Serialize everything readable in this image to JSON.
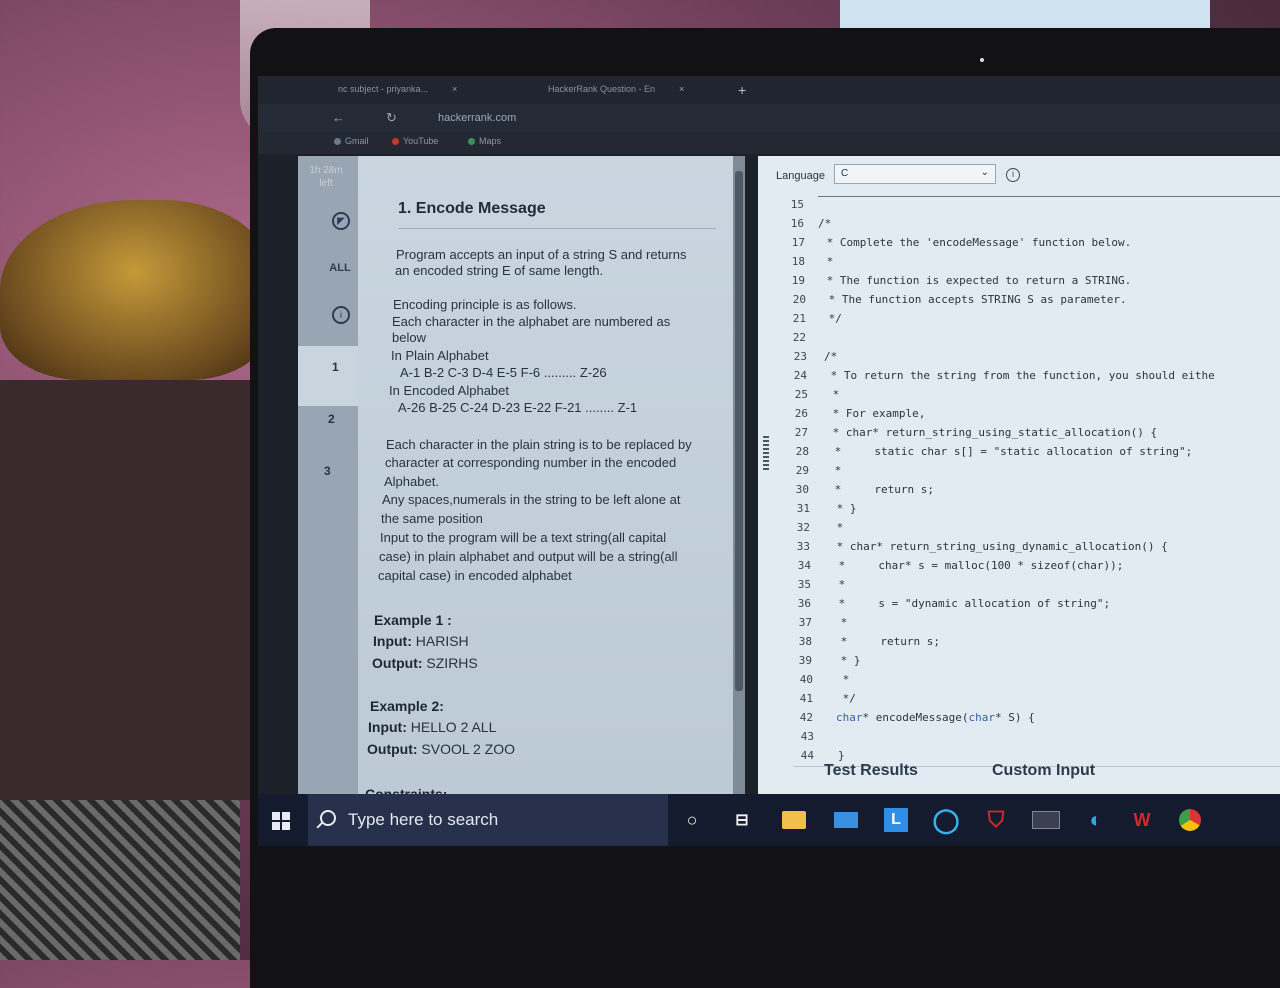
{
  "browser": {
    "tabs": [
      {
        "label": "nc subject - priyanka..."
      },
      {
        "label": "HackerRank Question - En"
      }
    ],
    "url": "hackerrank.com",
    "bookmarks": [
      "Gmail",
      "YouTube",
      "Maps"
    ]
  },
  "rail": {
    "timer": "1h 28m left",
    "all_label": "ALL",
    "questions": [
      "1",
      "2",
      "3"
    ]
  },
  "problem": {
    "title": "1. Encode Message",
    "lines": [
      "Program accepts an input of a string S and returns",
      "an encoded string E of same length.",
      "Encoding principle is as follows.",
      "Each character in the alphabet are numbered as",
      "below",
      "In Plain Alphabet",
      "A-1 B-2 C-3 D-4  E-5 F-6 ......... Z-26",
      "In Encoded Alphabet",
      "A-26 B-25 C-24 D-23 E-22 F-21 ........ Z-1",
      "Each character in the plain string is to be replaced by",
      "character at corresponding number in the encoded",
      "Alphabet.",
      "Any spaces,numerals in the string to be left alone at",
      "the same position",
      "Input to the program will be a text string(all capital",
      "case) in plain alphabet and output will be a string(all",
      "capital case) in encoded alphabet"
    ],
    "example1": {
      "heading": "Example 1 :",
      "input_label": "Input:",
      "input": "HARISH",
      "output_label": "Output:",
      "output": "SZIRHS"
    },
    "example2": {
      "heading": "Example 2:",
      "input_label": "Input:",
      "input": "HELLO 2 ALL",
      "output_label": "Output:",
      "output": "SVOOL 2 ZOO"
    },
    "constraints": "Constraints:"
  },
  "editor": {
    "language_label": "Language",
    "language": "C",
    "code": [
      {
        "n": "15",
        "t": ""
      },
      {
        "n": "16",
        "t": "/*"
      },
      {
        "n": "17",
        "t": " * Complete the 'encodeMessage' function below."
      },
      {
        "n": "18",
        "t": " *"
      },
      {
        "n": "19",
        "t": " * The function is expected to return a STRING."
      },
      {
        "n": "20",
        "t": " * The function accepts STRING S as parameter."
      },
      {
        "n": "21",
        "t": " */"
      },
      {
        "n": "22",
        "t": ""
      },
      {
        "n": "23",
        "t": "/*"
      },
      {
        "n": "24",
        "t": " * To return the string from the function, you should eithe"
      },
      {
        "n": "25",
        "t": " *"
      },
      {
        "n": "26",
        "t": " * For example,"
      },
      {
        "n": "27",
        "t": " * char* return_string_using_static_allocation() {"
      },
      {
        "n": "28",
        "t": " *     static char s[] = \"static allocation of string\";"
      },
      {
        "n": "29",
        "t": " *"
      },
      {
        "n": "30",
        "t": " *     return s;"
      },
      {
        "n": "31",
        "t": " * }"
      },
      {
        "n": "32",
        "t": " *"
      },
      {
        "n": "33",
        "t": " * char* return_string_using_dynamic_allocation() {"
      },
      {
        "n": "34",
        "t": " *     char* s = malloc(100 * sizeof(char));"
      },
      {
        "n": "35",
        "t": " *"
      },
      {
        "n": "36",
        "t": " *     s = \"dynamic allocation of string\";"
      },
      {
        "n": "37",
        "t": " *"
      },
      {
        "n": "38",
        "t": " *     return s;"
      },
      {
        "n": "39",
        "t": " * }"
      },
      {
        "n": "40",
        "t": " *"
      },
      {
        "n": "41",
        "t": " */"
      },
      {
        "n": "42",
        "t": "char* encodeMessage(char* S) {"
      },
      {
        "n": "43",
        "t": ""
      },
      {
        "n": "44",
        "t": "}"
      }
    ],
    "bottom_tabs": [
      "Test Results",
      "Custom Input"
    ]
  },
  "taskbar": {
    "search_placeholder": "Type here to search",
    "icons": [
      "cortana-icon",
      "task-view-icon",
      "file-explorer-icon",
      "mail-icon",
      "l-app-icon",
      "circle-app-icon",
      "mcafee-icon",
      "video-app-icon",
      "edge-icon",
      "wps-icon",
      "chrome-icon"
    ]
  },
  "colors": {
    "problem_bg": "#c9d6e0",
    "editor_bg": "#e3ebf2",
    "taskbar_bg": "#141b2e",
    "keyword": "#3a5fb0"
  }
}
